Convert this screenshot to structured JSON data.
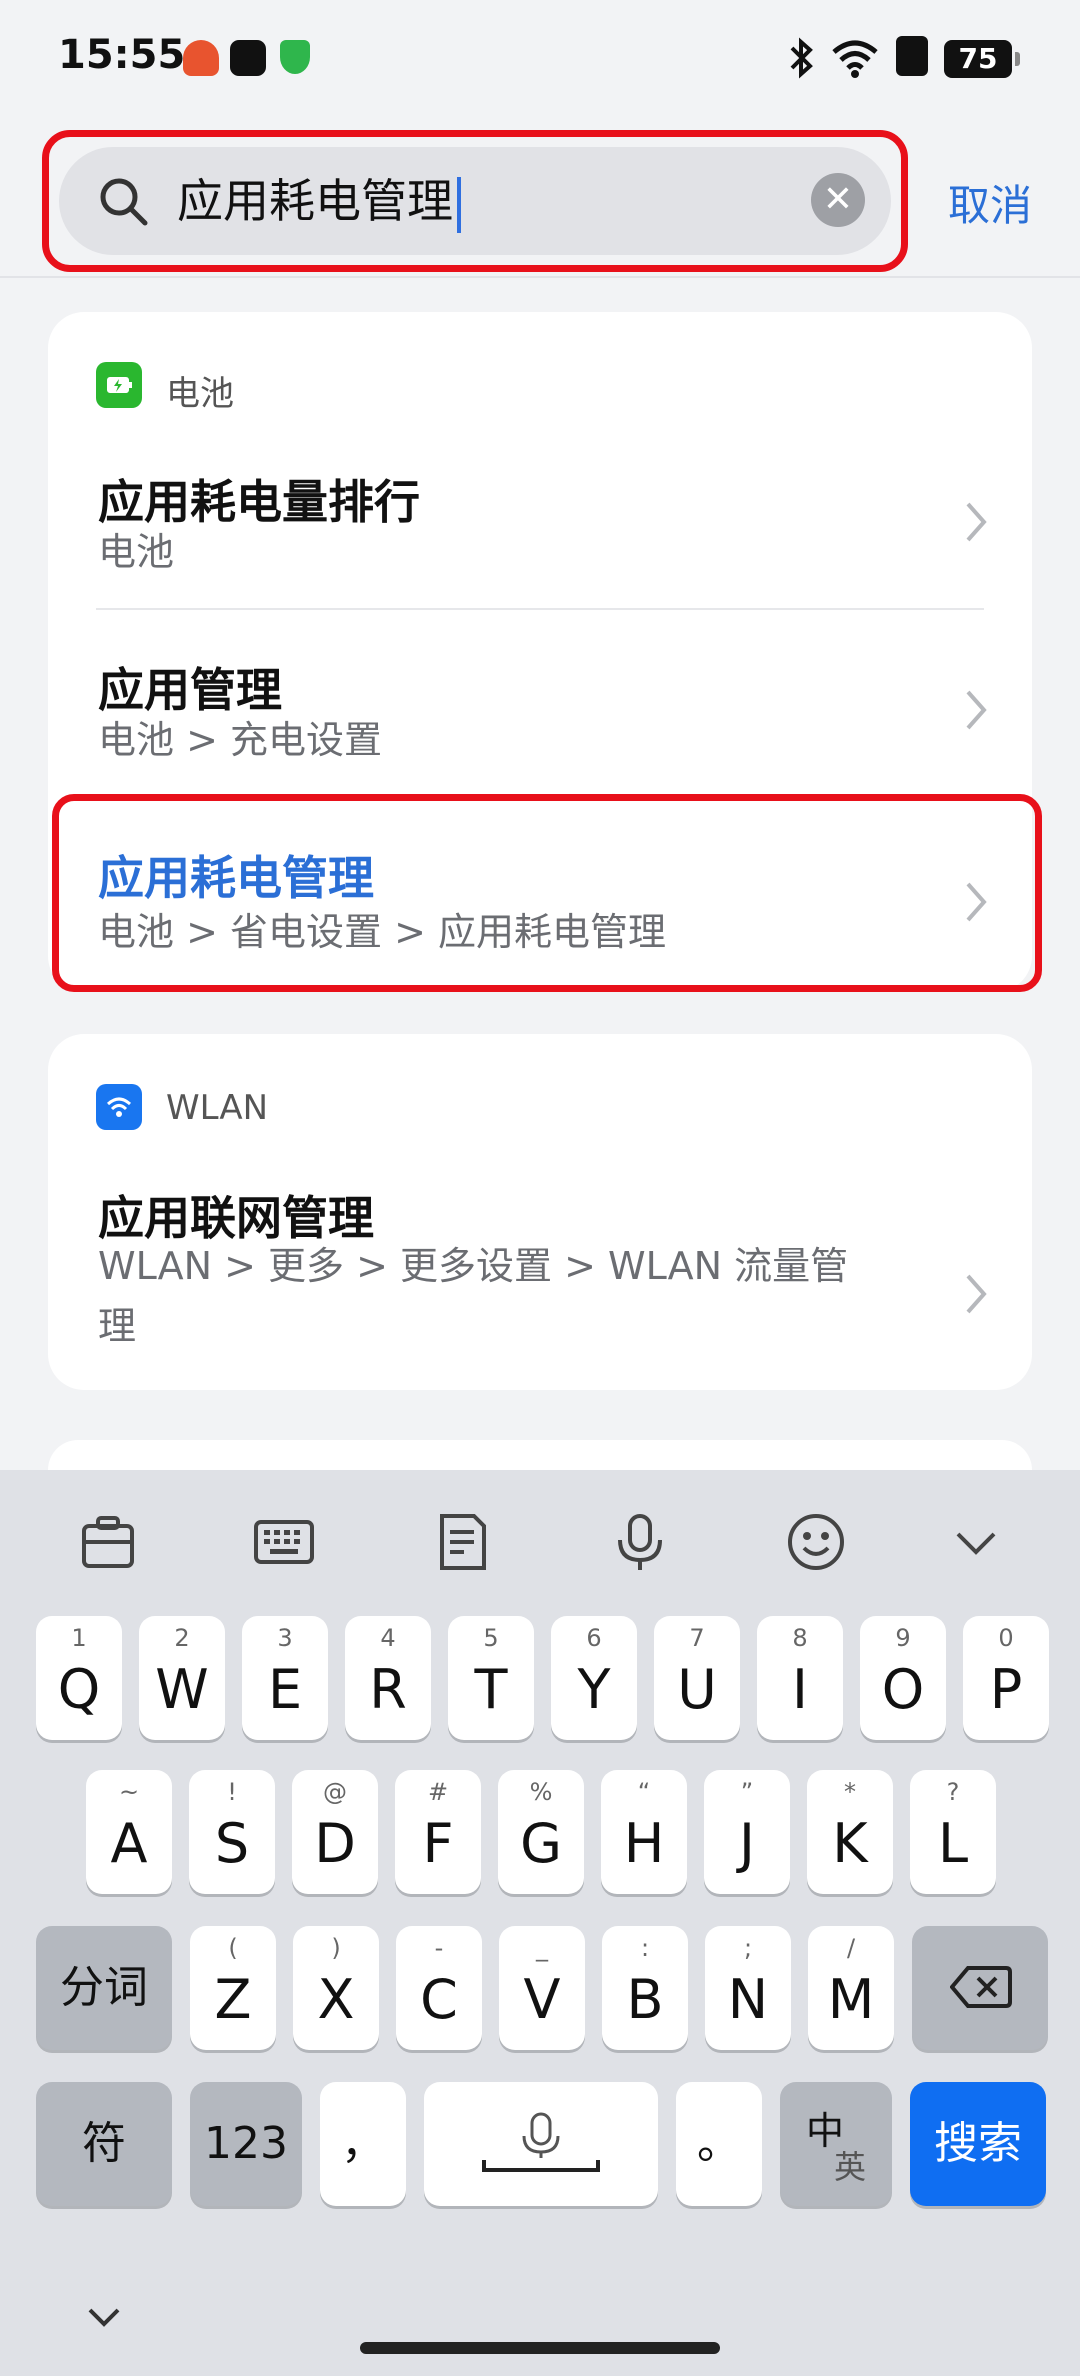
{
  "status_bar": {
    "time": "15:55",
    "battery": "75"
  },
  "search": {
    "query": "应用耗电管理",
    "clear_icon": "close-icon",
    "cancel_label": "取消"
  },
  "sections": [
    {
      "category": "电池",
      "icon": "battery-icon",
      "items": [
        {
          "title": "应用耗电量排行",
          "path": "电池"
        },
        {
          "title": "应用管理",
          "path": "电池 > 充电设置"
        },
        {
          "title": "应用耗电管理",
          "path": "电池 > 省电设置 > 应用耗电管理"
        }
      ]
    },
    {
      "category": "WLAN",
      "icon": "wifi-icon",
      "items": [
        {
          "title": "应用联网管理",
          "path": "WLAN > 更多 > 更多设置 > WLAN 流量管理"
        }
      ]
    }
  ],
  "keyboard": {
    "toolbar": [
      "clipboard-icon",
      "keyboard-icon",
      "document-icon",
      "microphone-icon",
      "emoji-icon",
      "collapse-icon"
    ],
    "row1": [
      {
        "hint": "1",
        "key": "Q"
      },
      {
        "hint": "2",
        "key": "W"
      },
      {
        "hint": "3",
        "key": "E"
      },
      {
        "hint": "4",
        "key": "R"
      },
      {
        "hint": "5",
        "key": "T"
      },
      {
        "hint": "6",
        "key": "Y"
      },
      {
        "hint": "7",
        "key": "U"
      },
      {
        "hint": "8",
        "key": "I"
      },
      {
        "hint": "9",
        "key": "O"
      },
      {
        "hint": "0",
        "key": "P"
      }
    ],
    "row2": [
      {
        "hint": "~",
        "key": "A"
      },
      {
        "hint": "!",
        "key": "S"
      },
      {
        "hint": "@",
        "key": "D"
      },
      {
        "hint": "#",
        "key": "F"
      },
      {
        "hint": "%",
        "key": "G"
      },
      {
        "hint": "“",
        "key": "H"
      },
      {
        "hint": "”",
        "key": "J"
      },
      {
        "hint": "*",
        "key": "K"
      },
      {
        "hint": "?",
        "key": "L"
      }
    ],
    "row3_left": "分词",
    "row3": [
      {
        "hint": "(",
        "key": "Z"
      },
      {
        "hint": ")",
        "key": "X"
      },
      {
        "hint": "-",
        "key": "C"
      },
      {
        "hint": "_",
        "key": "V"
      },
      {
        "hint": ":",
        "key": "B"
      },
      {
        "hint": ";",
        "key": "N"
      },
      {
        "hint": "/",
        "key": "M"
      }
    ],
    "symbols_label": "符",
    "numbers_label": "123",
    "comma": "，",
    "period": "。",
    "lang_top": "中",
    "lang_bottom": "英",
    "search_label": "搜索"
  }
}
